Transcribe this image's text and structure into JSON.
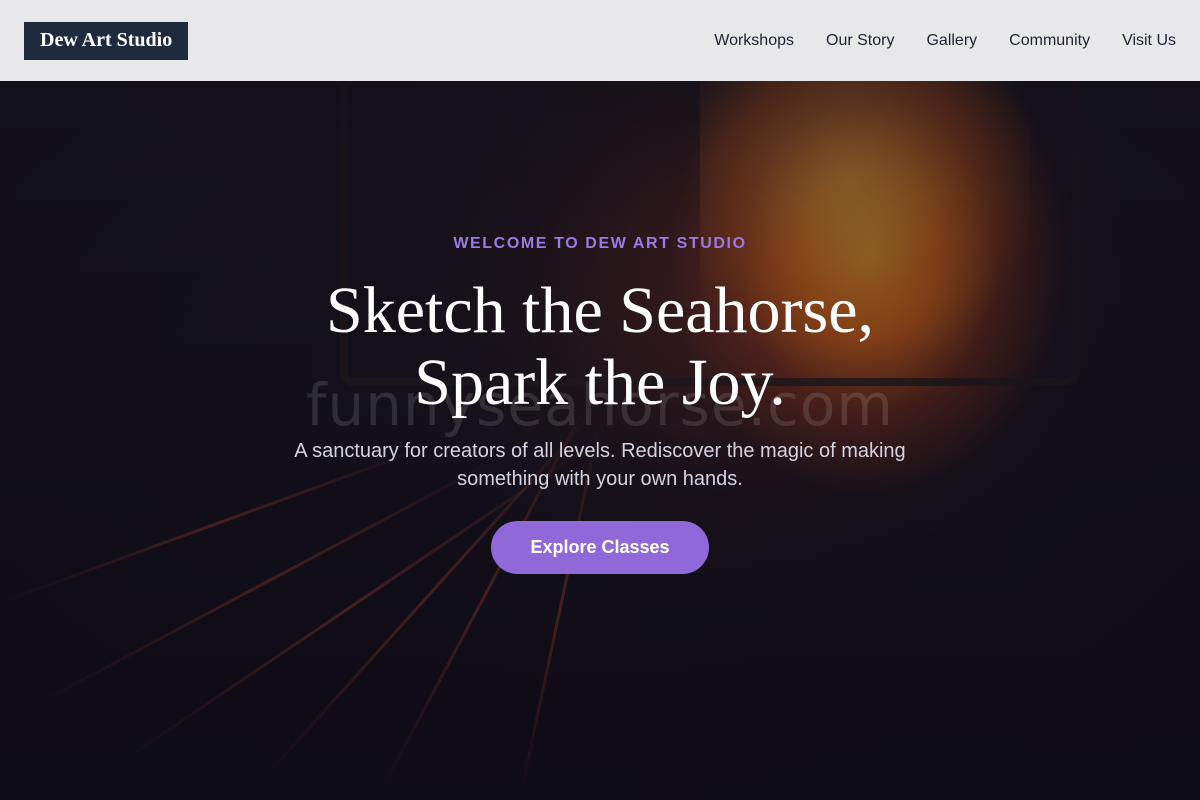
{
  "header": {
    "logo": "Dew Art Studio",
    "nav": [
      "Workshops",
      "Our Story",
      "Gallery",
      "Community",
      "Visit Us"
    ]
  },
  "hero": {
    "eyebrow": "WELCOME TO DEW ART STUDIO",
    "headline_line1": "Sketch the Seahorse,",
    "headline_line2": "Spark the Joy.",
    "subtitle": "A sanctuary for creators of all levels. Rediscover the magic of making something with your own hands.",
    "cta_label": "Explore Classes",
    "watermark": "funnyseahorse.com"
  },
  "colors": {
    "logo_bg": "#1e2a3e",
    "header_bg": "#e8e8ea",
    "accent": "#9069d8",
    "eyebrow": "#9d79e3"
  }
}
